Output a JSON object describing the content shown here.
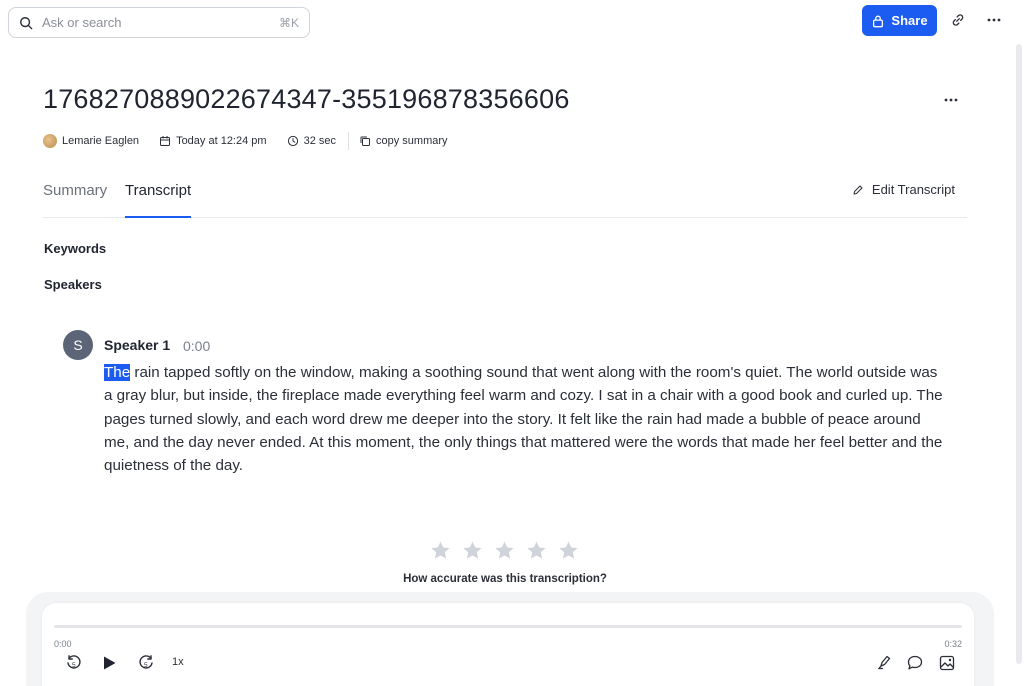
{
  "search": {
    "placeholder": "Ask or search",
    "shortcut": "⌘K",
    "icon": "search-icon"
  },
  "header": {
    "share_label": "Share",
    "share_icon": "lock-icon",
    "link_icon": "link-icon",
    "more_icon": "more-horizontal-icon"
  },
  "page": {
    "title": "17682708890226​74347-355196878356606",
    "meta": {
      "author": "Lemarie Eaglen",
      "date": "Today at 12:24 pm",
      "duration": "32 sec",
      "copy_label": "copy summary"
    }
  },
  "tabs": [
    {
      "label": "Summary",
      "active": false
    },
    {
      "label": "Transcript",
      "active": true
    }
  ],
  "edit_label": "Edit Transcript",
  "sections": {
    "keywords": "Keywords",
    "speakers": "Speakers"
  },
  "transcript": {
    "speaker_initial": "S",
    "speaker_name": "Speaker 1",
    "timestamp": "0:00",
    "highlighted_word": "The",
    "text": " rain tapped softly on the window, making a soothing sound that went along with the room's quiet. The world outside was a gray blur, but inside, the fireplace made everything feel warm and cozy. I sat in a chair with a good book and curled up. The pages turned slowly, and each word drew me deeper into the story. It felt like the rain had made a bubble of peace around me, and the day never ended. At this moment, the only things that mattered were the words that made her feel better and the quietness of the day."
  },
  "rating": {
    "question": "How accurate was this transcription?",
    "stars": 5,
    "selected": 0,
    "star_color": "#cfd3da"
  },
  "player": {
    "current_time": "0:00",
    "total_time": "0:32",
    "progress": 0,
    "speed": "1x",
    "icons": [
      "rewind-5-icon",
      "play-icon",
      "forward-5-icon",
      "highlighter-icon",
      "comment-icon",
      "image-icon"
    ]
  },
  "colors": {
    "accent": "#1d5cf0",
    "text": "#1f2430",
    "muted": "#6a707a"
  }
}
